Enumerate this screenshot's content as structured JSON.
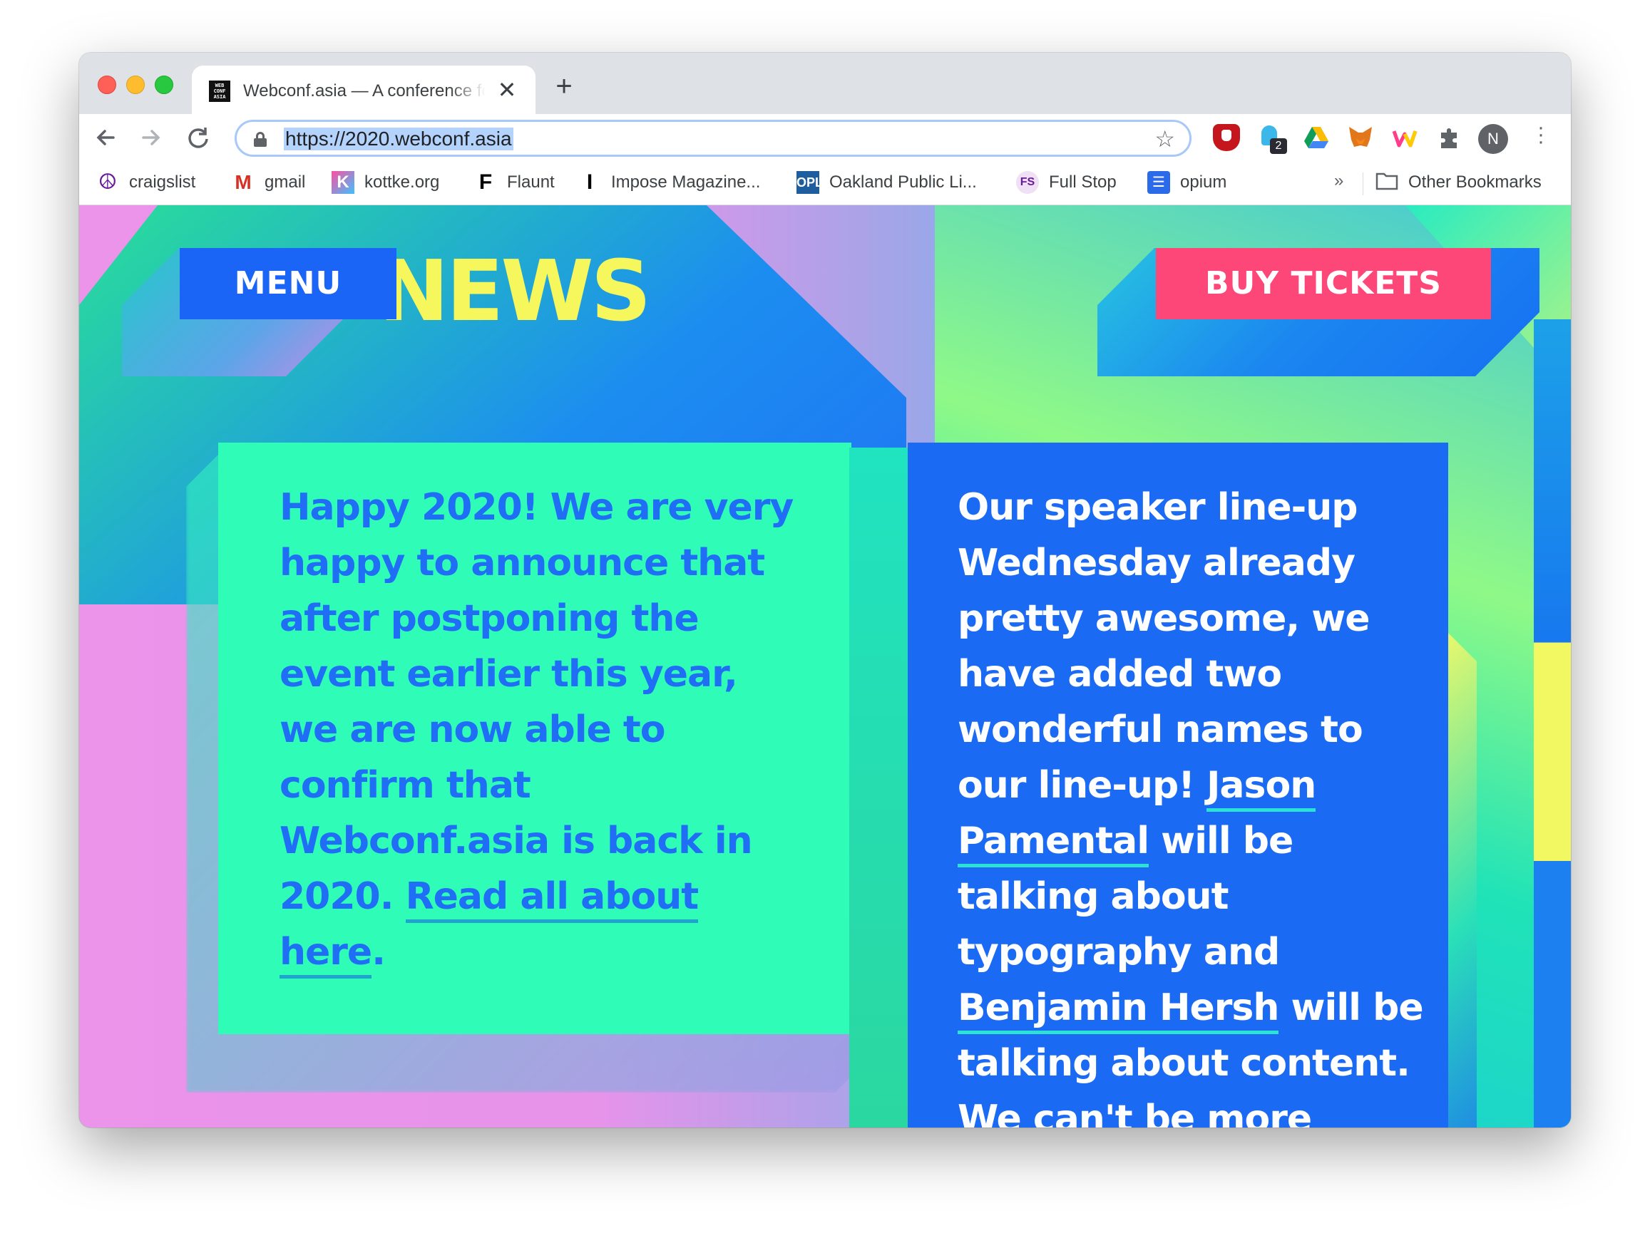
{
  "browser": {
    "tab": {
      "favicon_text": "WEB CONF ASIA",
      "title": "Webconf.asia — A conference for web designers and developers"
    },
    "new_tab_label": "+",
    "close_tab_label": "✕",
    "url": "https://2020.webconf.asia",
    "profile_initial": "N",
    "extension_badge": "2"
  },
  "bookmarks": [
    {
      "label": "craigslist",
      "icon": "peace-icon"
    },
    {
      "label": "gmail",
      "icon": "gmail-icon"
    },
    {
      "label": "kottke.org",
      "icon": "kottke-icon"
    },
    {
      "label": "Flaunt",
      "icon": "flaunt-icon"
    },
    {
      "label": "Impose Magazine...",
      "icon": "impose-icon"
    },
    {
      "label": "Oakland Public Li...",
      "icon": "library-icon"
    },
    {
      "label": "Full Stop",
      "icon": "fullstop-icon"
    },
    {
      "label": "opium",
      "icon": "opium-icon"
    }
  ],
  "bookmarks_more": "»",
  "other_bookmarks": "Other Bookmarks",
  "page": {
    "menu_label": "MENU",
    "buy_label": "BUY TICKETS",
    "heading_visible": "NEWS",
    "left_card": {
      "text": "Happy 2020! We are very happy to announce that after postponing the event earlier this year, we are now able to confirm that Webconf.asia is back in 2020.",
      "link": "Read all about here",
      "tail": "."
    },
    "right_card": {
      "text_before": "Our speaker line-up Wednesday already pretty awesome, we have added two wonderful names to our line-up!",
      "speaker1": "Jason Pamental",
      "text_mid": "will be talking about typography and",
      "speaker2": "Benjamin Hersh",
      "text_after": "will be talking about content. We can't be more excited!"
    }
  },
  "colors": {
    "accent_blue": "#1b6af4",
    "accent_pink": "#fc4778",
    "accent_green": "#2efcb7",
    "accent_yellow": "#f5f75c"
  }
}
